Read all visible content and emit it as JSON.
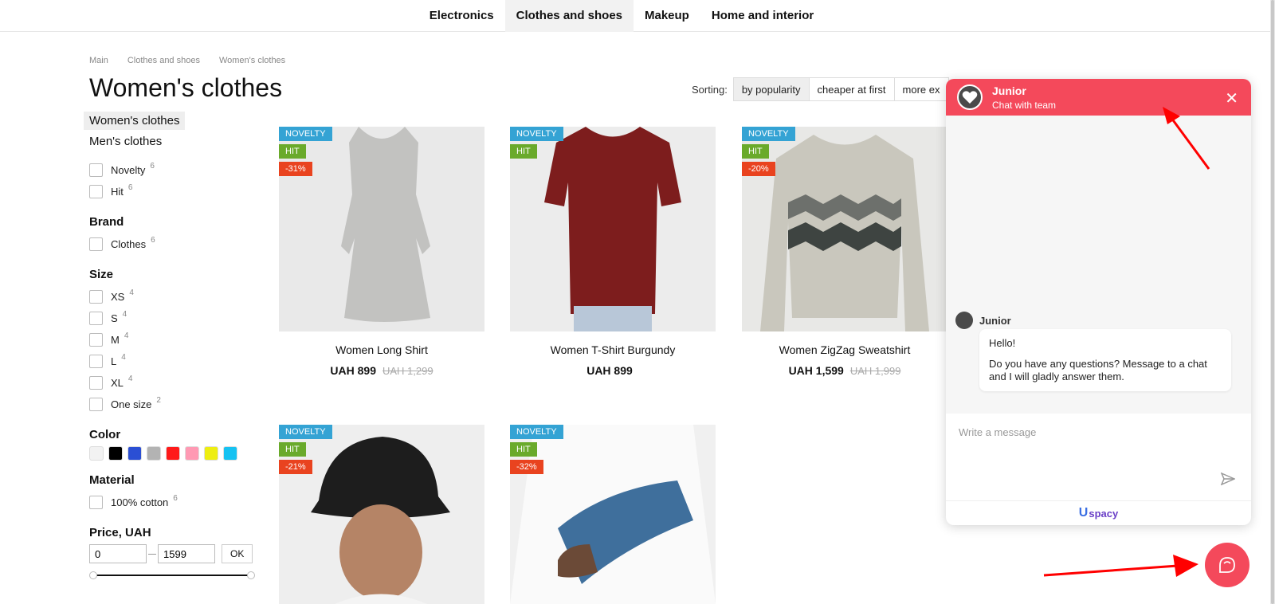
{
  "topnav": {
    "items": [
      "Electronics",
      "Clothes and shoes",
      "Makeup",
      "Home and interior"
    ]
  },
  "breadcrumb": [
    "Main",
    "Clothes and shoes",
    "Women's clothes"
  ],
  "page_title": "Women's clothes",
  "sorting": {
    "label": "Sorting:",
    "options": [
      "by popularity",
      "cheaper at first",
      "more ex"
    ]
  },
  "sidebar": {
    "categories": [
      "Women's clothes",
      "Men's clothes"
    ],
    "flags": [
      {
        "label": "Novelty",
        "count": "6"
      },
      {
        "label": "Hit",
        "count": "6"
      }
    ],
    "brand_title": "Brand",
    "brand": [
      {
        "label": "Clothes",
        "count": "6"
      }
    ],
    "size_title": "Size",
    "sizes": [
      {
        "label": "XS",
        "count": "4"
      },
      {
        "label": "S",
        "count": "4"
      },
      {
        "label": "M",
        "count": "4"
      },
      {
        "label": "L",
        "count": "4"
      },
      {
        "label": "XL",
        "count": "4"
      },
      {
        "label": "One size",
        "count": "2"
      }
    ],
    "color_title": "Color",
    "colors": [
      "#f2f2f2",
      "#000000",
      "#2b4fd4",
      "#b3b3b3",
      "#ff1a1a",
      "#ff99b3",
      "#eeee11",
      "#16c2f2"
    ],
    "material_title": "Material",
    "materials": [
      {
        "label": "100% cotton",
        "count": "6"
      }
    ],
    "price_title": "Price, UAH",
    "price_min": "0",
    "price_max": "1599",
    "ok_label": "OK"
  },
  "products": [
    {
      "name": "Women Long Shirt",
      "price": "UAH 899",
      "old_price": "UAH 1,299",
      "badges": [
        "NOVELTY",
        "HIT",
        "-31%"
      ]
    },
    {
      "name": "Women T-Shirt Burgundy",
      "price": "UAH 899",
      "old_price": "",
      "badges": [
        "NOVELTY",
        "HIT"
      ]
    },
    {
      "name": "Women ZigZag Sweatshirt",
      "price": "UAH 1,599",
      "old_price": "UAH 1,999",
      "badges": [
        "NOVELTY",
        "HIT",
        "-20%"
      ]
    },
    {
      "name": "",
      "price": "",
      "old_price": "",
      "badges": [
        "NOVELTY",
        "HIT",
        "-21%"
      ]
    },
    {
      "name": "",
      "price": "",
      "old_price": "",
      "badges": [
        "NOVELTY",
        "HIT",
        "-32%"
      ]
    }
  ],
  "chat": {
    "name": "Junior",
    "subtitle": "Chat with team",
    "author": "Junior",
    "message_1": "Hello!",
    "message_2": "Do you have any questions? Message to a chat and I will gladly answer them.",
    "placeholder": "Write a message",
    "brand": "spacy",
    "accent": "#f4495b"
  }
}
